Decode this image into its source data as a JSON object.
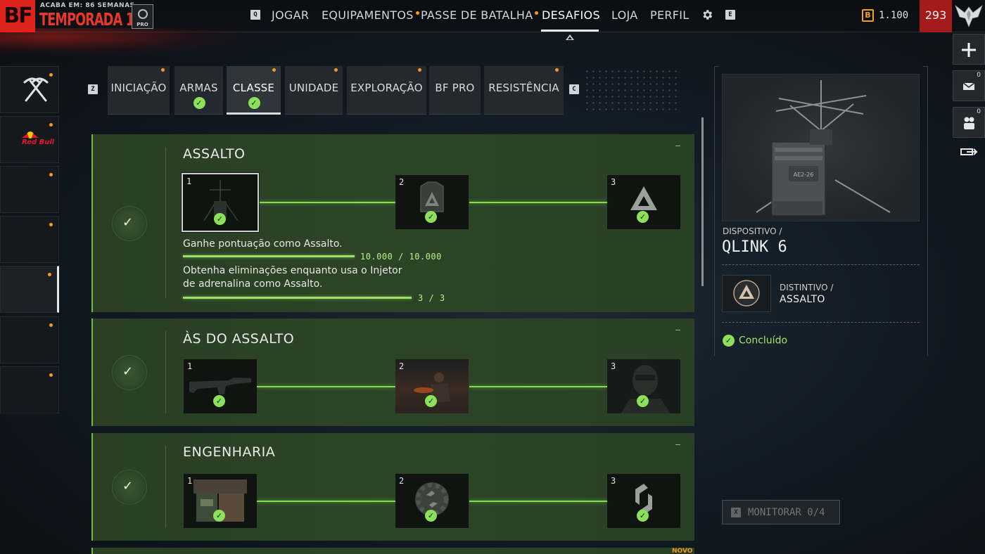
{
  "header": {
    "brand": "BF",
    "season_subtitle": "ACABA EM: 86 SEMANAS",
    "season_title": "TEMPORADA 1",
    "pro_label": "PRO",
    "key_left": "Q",
    "key_right": "E",
    "nav": [
      {
        "label": "JOGAR",
        "dot": false
      },
      {
        "label": "EQUIPAMENTOS",
        "dot": true
      },
      {
        "label": "PASSE DE BATALHA",
        "dot": true
      },
      {
        "label": "DESAFIOS",
        "dot": false,
        "active": true
      },
      {
        "label": "LOJA",
        "dot": false
      },
      {
        "label": "PERFIL",
        "dot": false
      }
    ],
    "currency_symbol": "B",
    "currency_value": "1.100",
    "level": "293"
  },
  "sidebar": {
    "redbull_label": "Red Bull"
  },
  "tabs": {
    "key_left": "Z",
    "key_right": "C",
    "items": [
      {
        "label": "INICIAÇÃO",
        "dot": true,
        "checked": false
      },
      {
        "label": "ARMAS",
        "dot": false,
        "checked": true
      },
      {
        "label": "CLASSE",
        "dot": true,
        "checked": true,
        "active": true
      },
      {
        "label": "UNIDADE",
        "dot": true,
        "checked": false
      },
      {
        "label": "EXPLORAÇÃO",
        "dot": true,
        "checked": false
      },
      {
        "label": "BF PRO",
        "dot": false,
        "checked": false
      },
      {
        "label": "RESISTÊNCIA",
        "dot": true,
        "checked": false
      }
    ]
  },
  "challenges": [
    {
      "title": "ASSALTO",
      "tiers": [
        "1",
        "2",
        "3"
      ],
      "objectives": [
        {
          "text": "Ganhe pontuação como Assalto.",
          "progress": "10.000 / 10.000",
          "fraction": 1.0
        },
        {
          "text_line1": "Obtenha eliminações enquanto usa o Injetor",
          "text_line2": "de adrenalina como Assalto.",
          "progress": "3 / 3",
          "fraction": 1.0
        }
      ]
    },
    {
      "title": "ÀS DO ASSALTO",
      "tiers": [
        "1",
        "2",
        "3"
      ]
    },
    {
      "title": "ENGENHARIA",
      "tiers": [
        "1",
        "2",
        "3"
      ]
    }
  ],
  "new_tag": "NOVO",
  "detail": {
    "category": "DISPOSITIVO /",
    "name": "QLINK 6",
    "device_marking": "AE2-26",
    "badge_category": "DISTINTIVO /",
    "badge_name": "ASSALTO",
    "status": "Concluído",
    "monitor_key": "X",
    "monitor_label": "MONITORAR 0/4"
  },
  "right_buttons": {
    "mail_count": "0",
    "squad_count": "0"
  },
  "colors": {
    "accent_green": "#8de05a",
    "notification": "#f59a1c",
    "brand_red": "#e0241c"
  }
}
